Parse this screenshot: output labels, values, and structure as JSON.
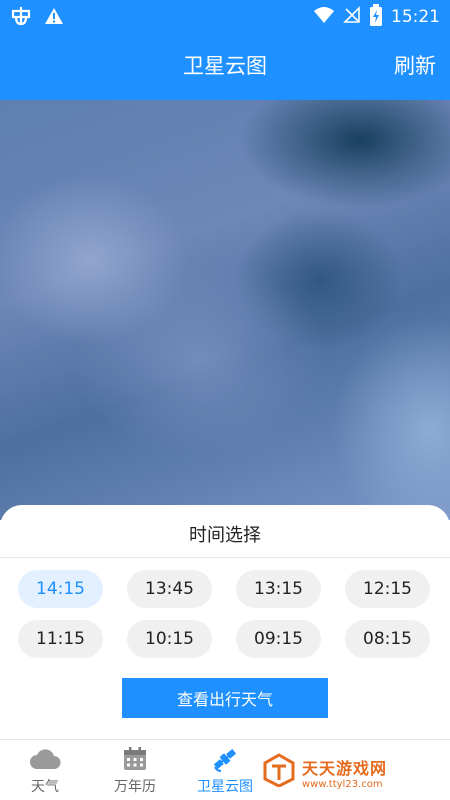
{
  "status_bar": {
    "time": "15:21"
  },
  "app_bar": {
    "title": "卫星云图",
    "refresh_label": "刷新"
  },
  "sheet": {
    "title": "时间选择",
    "times": [
      {
        "label": "14:15",
        "selected": true
      },
      {
        "label": "13:45",
        "selected": false
      },
      {
        "label": "13:15",
        "selected": false
      },
      {
        "label": "12:15",
        "selected": false
      },
      {
        "label": "11:15",
        "selected": false
      },
      {
        "label": "10:15",
        "selected": false
      },
      {
        "label": "09:15",
        "selected": false
      },
      {
        "label": "08:15",
        "selected": false
      }
    ],
    "cta_label": "查看出行天气"
  },
  "bottom_nav": {
    "items": [
      {
        "label": "天气",
        "icon": "cloud-icon",
        "active": false
      },
      {
        "label": "万年历",
        "icon": "calendar-icon",
        "active": false
      },
      {
        "label": "卫星云图",
        "icon": "satellite-icon",
        "active": true
      }
    ]
  },
  "watermark": {
    "name": "天天游戏网",
    "url": "www.ttyl23.com"
  },
  "colors": {
    "primary": "#1e90ff",
    "chip_bg": "#f0f0f0",
    "chip_selected_bg": "#e3f0ff",
    "watermark": "#e56b1f"
  }
}
